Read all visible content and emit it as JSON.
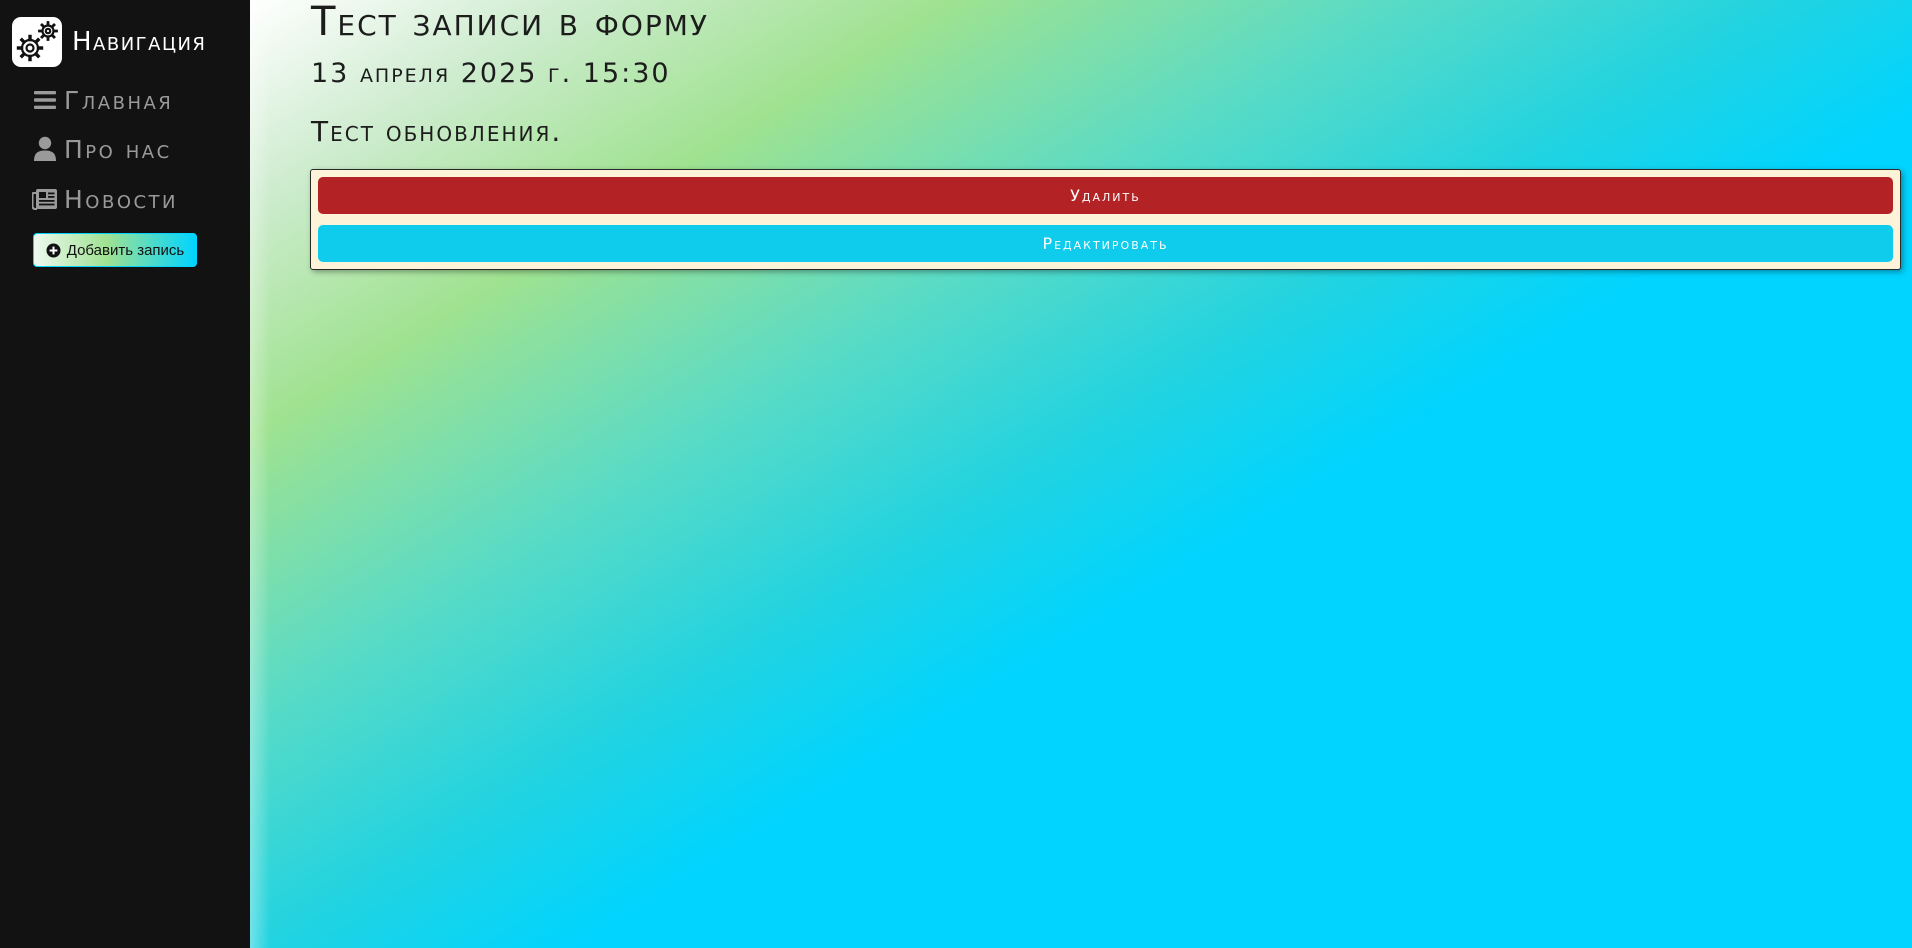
{
  "sidebar": {
    "brand": {
      "title": "Навигация",
      "icon": "gears-icon"
    },
    "items": [
      {
        "label": "Главная",
        "icon": "bars-icon"
      },
      {
        "label": "Про нас",
        "icon": "user-icon"
      },
      {
        "label": "Новости",
        "icon": "newspaper-icon"
      }
    ],
    "add_button": {
      "label": "Добавить запись",
      "icon": "plus-circle-icon"
    }
  },
  "post": {
    "title": "Тест записи в форму",
    "date": "13 апреля 2025 г. 15:30",
    "body": "Тест обновления."
  },
  "actions": {
    "delete_label": "Удалить",
    "edit_label": "Редактировать"
  },
  "colors": {
    "sidebar_bg": "#121212",
    "delete": "#b32224",
    "edit": "#0fcbec",
    "panel_bg": "#fdf3d8",
    "accent_cyan": "#00d4ff",
    "accent_green": "#9fe290"
  }
}
